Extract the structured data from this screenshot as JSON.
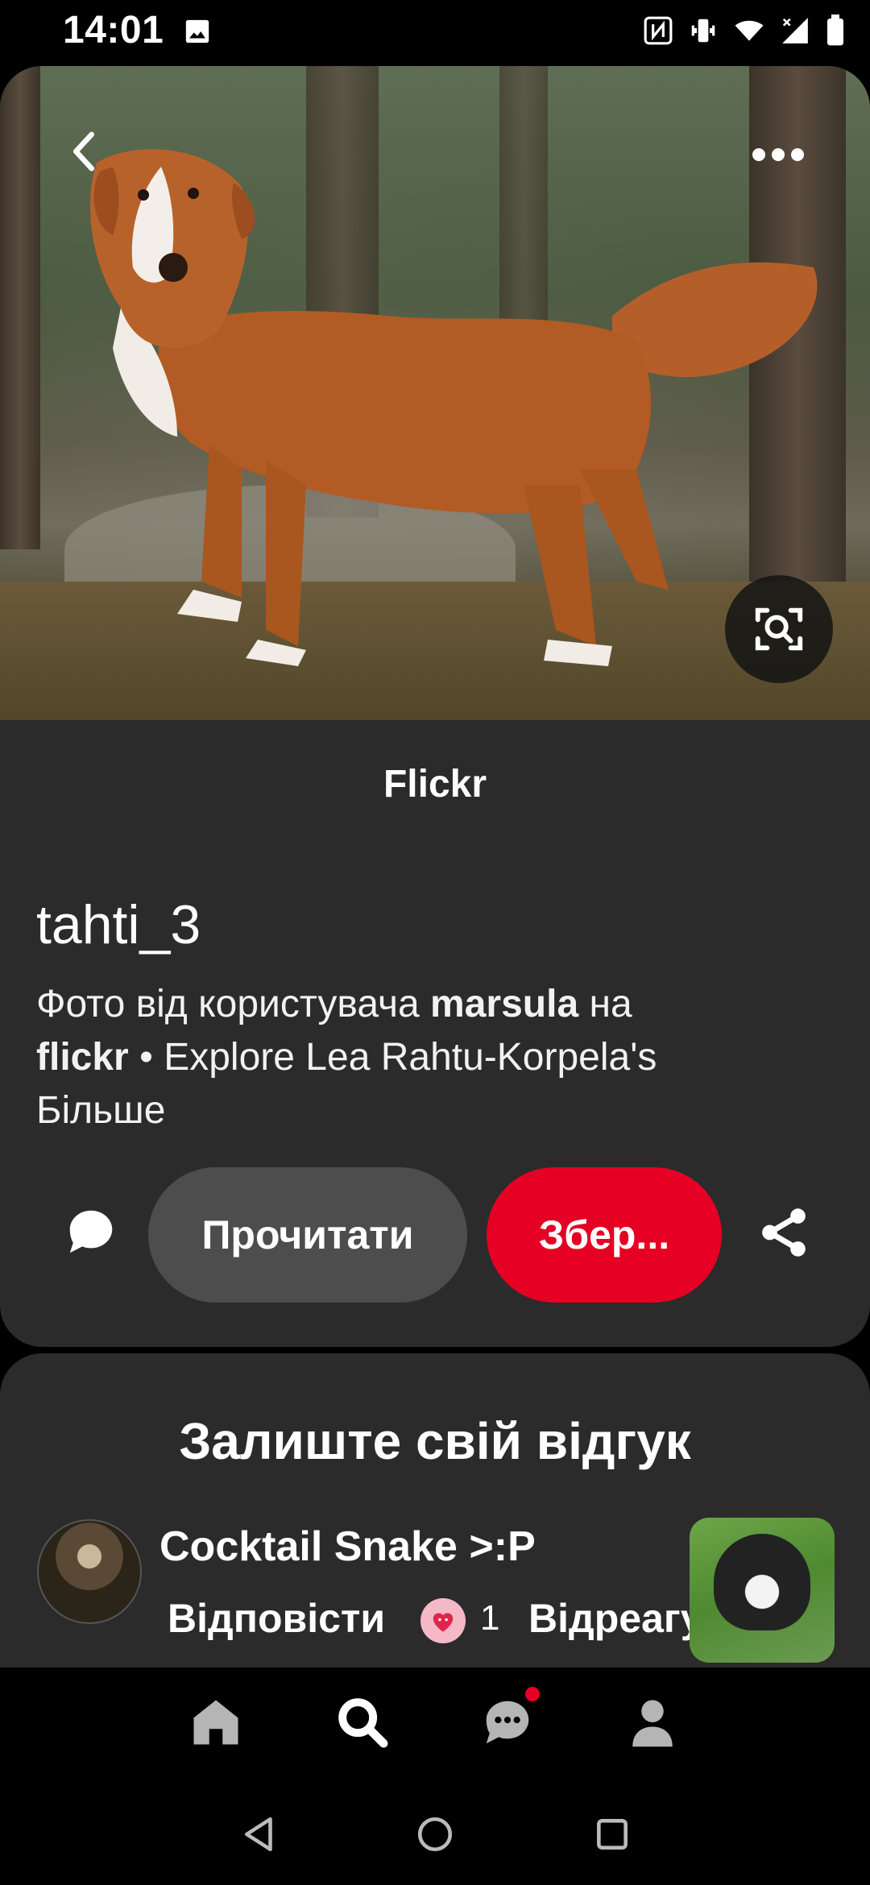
{
  "status_bar": {
    "time": "14:01",
    "icons": [
      "image-icon",
      "nfc-icon",
      "vibrate-icon",
      "wifi-icon",
      "signal-icon",
      "battery-icon"
    ]
  },
  "pin": {
    "source": "Flickr",
    "title": "tahti_3",
    "description_prefix": "Фото від користувача ",
    "description_user": "marsula",
    "description_mid": " на ",
    "description_site": "flickr",
    "description_suffix": " • Explore Lea Rahtu-Korpela's",
    "more_label": "Більше"
  },
  "actions": {
    "read_label": "Прочитати",
    "save_label": "Збер...",
    "save_color": "#e60023"
  },
  "comments": {
    "title": "Залиште свій відгук",
    "commenter": "Cocktail Snake >:P",
    "reply_label": "Відповісти",
    "reaction_count": "1",
    "react_label": "Відреагувати"
  },
  "nav": {
    "items": [
      "home-icon",
      "search-icon",
      "messages-icon",
      "profile-icon"
    ]
  }
}
